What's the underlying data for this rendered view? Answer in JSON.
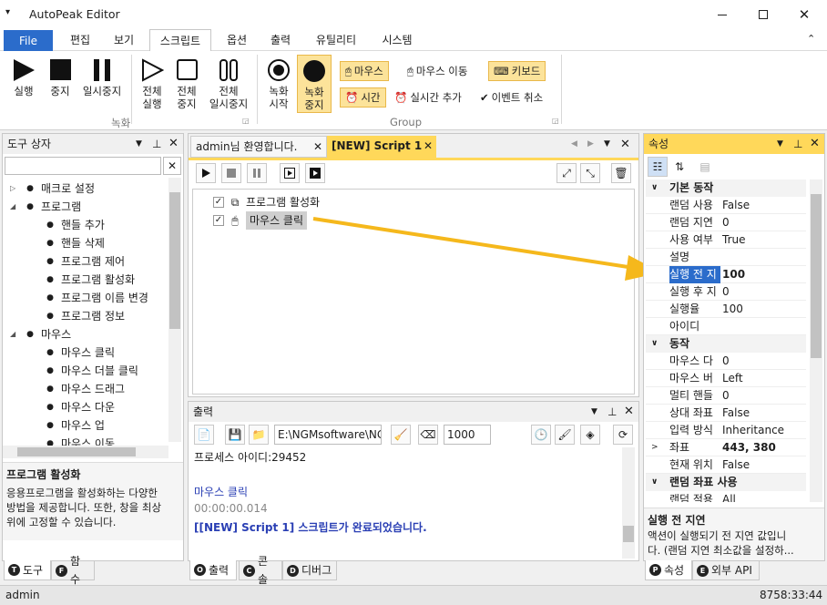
{
  "app": {
    "title": "AutoPeak Editor",
    "status_user": "admin",
    "status_time": "8758:33:44"
  },
  "menu": {
    "file": "File",
    "items": [
      "편집",
      "보기",
      "스크립트",
      "옵션",
      "출력",
      "유틸리티",
      "시스템"
    ]
  },
  "ribbon": {
    "run": "실행",
    "stop": "중지",
    "pause": "일시중지",
    "run_all": [
      "전체",
      "실행"
    ],
    "stop_all": [
      "전체",
      "중지"
    ],
    "pause_all": [
      "전체",
      "일시중지"
    ],
    "group_record": "녹화",
    "rec_start": [
      "녹화",
      "시작"
    ],
    "rec_stop": [
      "녹화",
      "중지"
    ],
    "mouse": "마우스",
    "mouse_move": "마우스 이동",
    "keyboard": "키보드",
    "time": "시간",
    "realtime_add": "실시간 추가",
    "event_cancel": "이벤트 취소",
    "group_group": "Group"
  },
  "toolbox": {
    "title": "도구 상자",
    "tree": [
      {
        "label": "매크로 설정",
        "level": 0,
        "icon": "globe-icon",
        "exp": "▷"
      },
      {
        "label": "프로그램",
        "level": 0,
        "icon": "monitor-icon",
        "exp": "◢"
      },
      {
        "label": "핸들 추가",
        "level": 1,
        "icon": "crosshair-icon"
      },
      {
        "label": "핸들 삭제",
        "level": 1,
        "icon": "remove-handle-icon"
      },
      {
        "label": "프로그램 제어",
        "level": 1,
        "icon": "laptop-icon"
      },
      {
        "label": "프로그램 활성화",
        "level": 1,
        "icon": "windows-icon"
      },
      {
        "label": "프로그램 이름 변경",
        "level": 1,
        "icon": "rename-icon"
      },
      {
        "label": "프로그램 정보",
        "level": 1,
        "icon": "magnifier-icon"
      },
      {
        "label": "마우스",
        "level": 0,
        "icon": "mouse-icon",
        "exp": "◢"
      },
      {
        "label": "마우스 클릭",
        "level": 1,
        "icon": "mouse-click-icon"
      },
      {
        "label": "마우스 더블 클릭",
        "level": 1,
        "icon": "mouse-double-click-icon"
      },
      {
        "label": "마우스 드래그",
        "level": 1,
        "icon": "mouse-drag-icon"
      },
      {
        "label": "마우스 다운",
        "level": 1,
        "icon": "mouse-down-icon"
      },
      {
        "label": "마우스 업",
        "level": 1,
        "icon": "mouse-up-icon"
      },
      {
        "label": "마우스 이동",
        "level": 1,
        "icon": "mouse-move-icon"
      }
    ],
    "desc_title": "프로그램 활성화",
    "desc_lines": [
      "응용프로그램을 활성화하는 다양한",
      "방법을 제공합니다. 또한, 창을 최상",
      "위에 고정할 수 있습니다."
    ],
    "tabs": [
      {
        "key": "T",
        "label": "도구"
      },
      {
        "key": "F",
        "label": "함수"
      }
    ]
  },
  "editor": {
    "tabs": [
      "admin님 환영합니다.",
      "[NEW] Script 1"
    ],
    "items": [
      "프로그램 활성화",
      "마우스 클릭"
    ]
  },
  "output": {
    "title": "출력",
    "path": "E:\\NGMsoftware\\NG",
    "count": "1000",
    "lines": [
      {
        "text": "프로세스 아이디:29452",
        "color": "#1e1e1e"
      },
      {
        "text": "마우스 클릭",
        "color": "#2a3fb4"
      },
      {
        "text": "00:00:00.014",
        "color": "#888888"
      },
      {
        "text": "[[NEW] Script 1] 스크립트가 완료되었습니다.",
        "color": "#2a3fb4"
      }
    ],
    "tabs": [
      {
        "key": "O",
        "label": "출력"
      },
      {
        "key": "C",
        "label": "콘솔"
      },
      {
        "key": "D",
        "label": "디버그"
      }
    ]
  },
  "props": {
    "title": "속성",
    "rows": [
      {
        "cat": "기본 동작"
      },
      {
        "n": "랜덤 사용",
        "v": "False"
      },
      {
        "n": "랜덤 지연",
        "v": "0"
      },
      {
        "n": "사용 여부",
        "v": "True"
      },
      {
        "n": "설명",
        "v": ""
      },
      {
        "n": "실행 전 지",
        "v": "100",
        "sel": true
      },
      {
        "n": "실행 후 지",
        "v": "0"
      },
      {
        "n": "실행율",
        "v": "100"
      },
      {
        "n": "아이디",
        "v": ""
      },
      {
        "cat": "동작"
      },
      {
        "n": "마우스 다",
        "v": "0"
      },
      {
        "n": "마우스 버",
        "v": "Left"
      },
      {
        "n": "멀티 핸들",
        "v": "0"
      },
      {
        "n": "상대 좌표",
        "v": "False"
      },
      {
        "n": "입력 방식",
        "v": "Inheritance"
      },
      {
        "n": "좌표",
        "v": "443, 380",
        "bold": true,
        "exp": true
      },
      {
        "n": "현재 위치",
        "v": "False"
      },
      {
        "cat": "랜덤 좌표 사용"
      },
      {
        "n": "랜덤 적용",
        "v": "All"
      }
    ],
    "desc_title": "실행 전 지연",
    "desc_lines": [
      "액션이 실행되기 전 지연 값입니",
      "다. (랜덤 지연 최소값을 설정하..."
    ],
    "tabs": [
      {
        "key": "P",
        "label": "속성"
      },
      {
        "key": "E",
        "label": "외부 API"
      }
    ]
  },
  "colors": {
    "accent": "#2b6ccb",
    "highlight": "#fce39a",
    "arrow": "#f5b81c"
  }
}
